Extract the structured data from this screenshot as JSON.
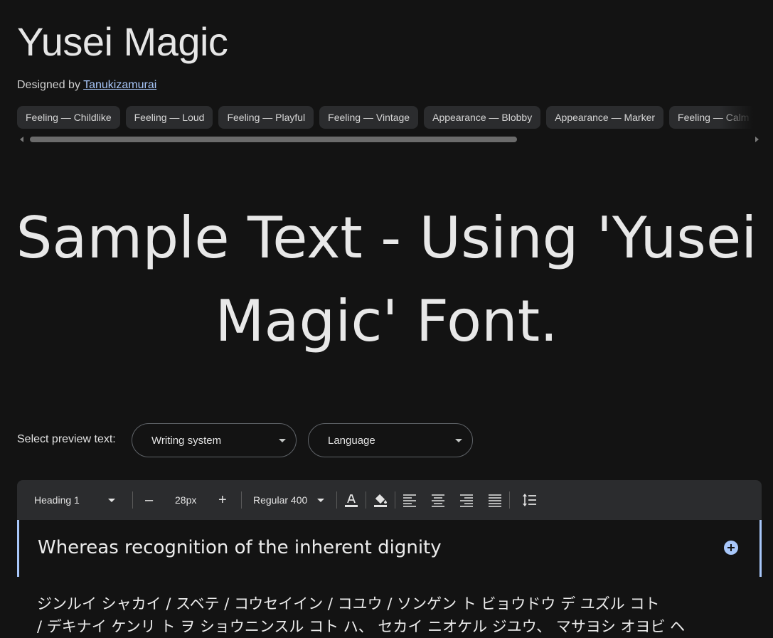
{
  "font": {
    "title": "Yusei Magic",
    "designed_by_label": "Designed by",
    "designer": "Tanukizamurai"
  },
  "tags": [
    "Feeling — Childlike",
    "Feeling — Loud",
    "Feeling — Playful",
    "Feeling — Vintage",
    "Appearance — Blobby",
    "Appearance — Marker",
    "Feeling — Calm"
  ],
  "sample_text": "Sample Text - Using 'Yusei Magic' Font.",
  "preview": {
    "label": "Select preview text:",
    "writing_system": "Writing system",
    "language": "Language"
  },
  "toolbar": {
    "style": "Heading 1",
    "size": "28px",
    "minus": "–",
    "plus": "+",
    "weight": "Regular 400"
  },
  "editor": {
    "heading": "Whereas recognition of the inherent dignity",
    "paragraph": "ジンルイ シャカイ / スベテ / コウセイイン / コユウ / ソンゲン ト ビョウドウ デ ユズル コト\n/ デキナイ ケンリ ト ヲ ショウニンスル コト ハ、 セカイ ニオケル ジユウ、 マサヨシ オヨビ ヘ"
  },
  "colors": {
    "background": "#131313",
    "chip": "#2b2c2e",
    "accent": "#a8c7fa"
  }
}
